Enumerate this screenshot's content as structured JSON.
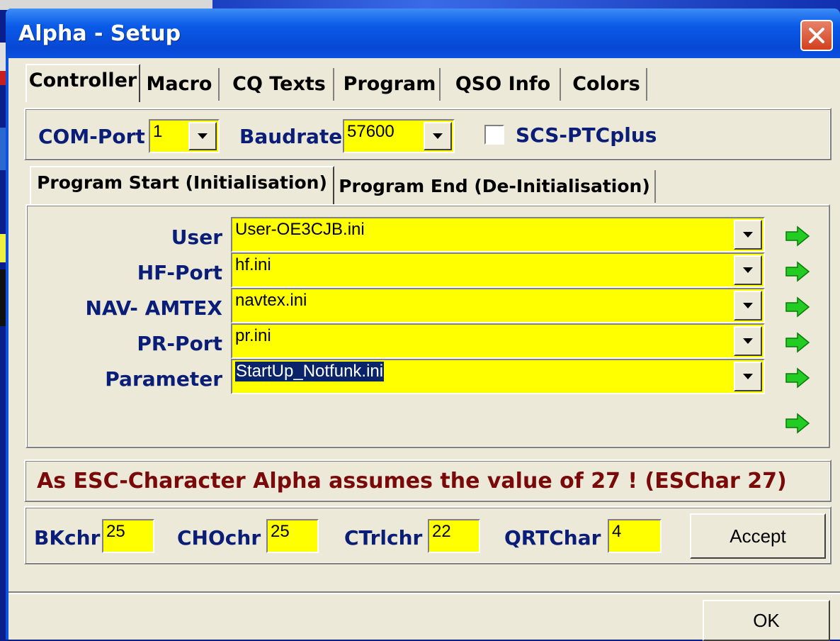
{
  "window": {
    "title": "Alpha - Setup"
  },
  "tabs": [
    {
      "label": "Controller",
      "active": true
    },
    {
      "label": "Macro"
    },
    {
      "label": "CQ Texts"
    },
    {
      "label": "Program"
    },
    {
      "label": "QSO Info"
    },
    {
      "label": "Colors"
    }
  ],
  "connection": {
    "com_port_label": "COM-Port",
    "com_port_value": "1",
    "baudrate_label": "Baudrate",
    "baudrate_value": "57600",
    "scs_label": "SCS-PTCplus",
    "scs_checked": false
  },
  "subtabs": [
    {
      "label": "Program Start (Initialisation)",
      "active": true
    },
    {
      "label": "Program End (De-Initialisation)"
    }
  ],
  "files": [
    {
      "label": "User",
      "value": "User-OE3CJB.ini"
    },
    {
      "label": "HF-Port",
      "value": "hf.ini"
    },
    {
      "label": "NAV- AMTEX",
      "value": "navtex.ini"
    },
    {
      "label": "PR-Port",
      "value": "pr.ini"
    },
    {
      "label": "Parameter",
      "value": "StartUp_Notfunk.ini",
      "selected": true
    }
  ],
  "esc_message": "As ESC-Character  Alpha assumes the value of 27 ! (ESChar 27)",
  "chars": {
    "bkchr_label": "BKchr",
    "bkchr_value": "25",
    "chochr_label": "CHOchr",
    "chochr_value": "25",
    "ctrlchr_label": "CTrlchr",
    "ctrlchr_value": "22",
    "qrtchar_label": "QRTChar",
    "qrtchar_value": "4"
  },
  "buttons": {
    "accept": "Accept",
    "ok": "OK"
  },
  "icons": {
    "close": "close-icon",
    "dropdown": "chevron-down-icon",
    "apply_arrow": "green-arrow-right-icon"
  },
  "colors": {
    "field_bg": "#ffff00",
    "label": "#0a1e78",
    "message": "#7a0a0a",
    "arrow": "#22cc22",
    "title_bar": "#0a5ae8"
  }
}
